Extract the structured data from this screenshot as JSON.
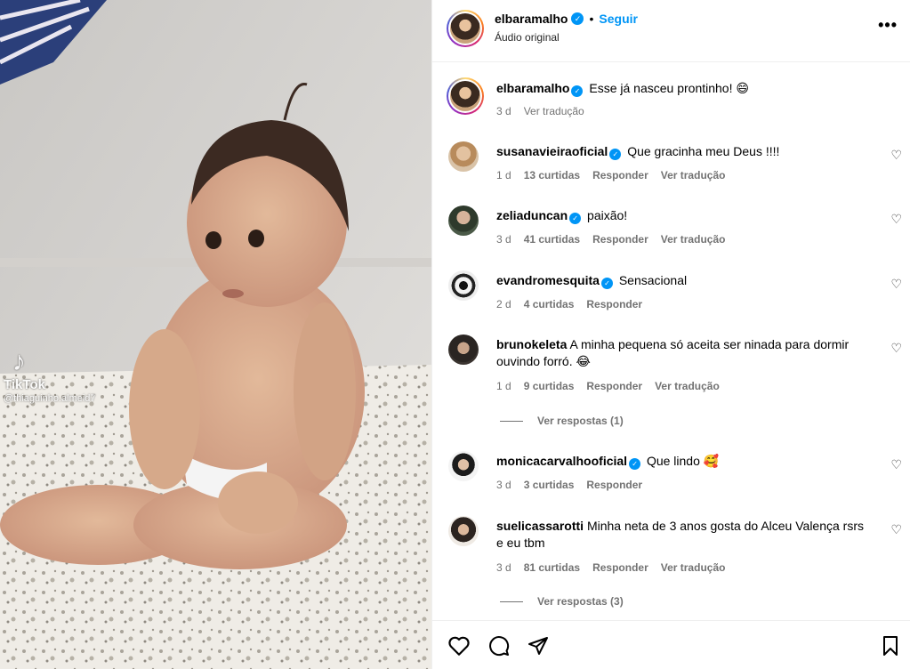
{
  "media": {
    "watermark": {
      "brand": "TikTok",
      "handle": "@thiaguinho.almeid7"
    }
  },
  "header": {
    "username": "elbaramalho",
    "separator": "•",
    "follow_label": "Seguir",
    "audio": "Áudio original",
    "more_label": "•••"
  },
  "caption": {
    "username": "elbaramalho",
    "text": "Esse já nasceu prontinho! 😄",
    "time": "3 d",
    "translate": "Ver tradução"
  },
  "comments": [
    {
      "username": "susanavieiraoficial",
      "verified": true,
      "text": "Que gracinha meu Deus !!!!",
      "time": "1 d",
      "likes": "13 curtidas",
      "reply": "Responder",
      "translate": "Ver tradução"
    },
    {
      "username": "zeliaduncan",
      "verified": true,
      "text": "paixão!",
      "time": "3 d",
      "likes": "41 curtidas",
      "reply": "Responder",
      "translate": "Ver tradução"
    },
    {
      "username": "evandromesquita",
      "verified": true,
      "text": "Sensacional",
      "time": "2 d",
      "likes": "4 curtidas",
      "reply": "Responder"
    },
    {
      "username": "brunokeleta",
      "verified": false,
      "text": "A minha pequena só aceita ser ninada para dormir ouvindo forró. 😂",
      "time": "1 d",
      "likes": "9 curtidas",
      "reply": "Responder",
      "translate": "Ver tradução",
      "view_replies": "Ver respostas (1)"
    },
    {
      "username": "monicacarvalhooficial",
      "verified": true,
      "text": "Que lindo 🥰",
      "time": "3 d",
      "likes": "3 curtidas",
      "reply": "Responder"
    },
    {
      "username": "suelicassarotti",
      "verified": false,
      "text": "Minha neta de 3 anos gosta do Alceu Valença rsrs e eu tbm",
      "time": "3 d",
      "likes": "81 curtidas",
      "reply": "Responder",
      "translate": "Ver tradução",
      "view_replies": "Ver respostas (3)"
    }
  ],
  "actions": [
    "like-icon",
    "comment-icon",
    "share-icon",
    "bookmark-icon"
  ],
  "colors": {
    "accent": "#0095f6",
    "secondary_text": "#737373",
    "border": "#efefef"
  }
}
